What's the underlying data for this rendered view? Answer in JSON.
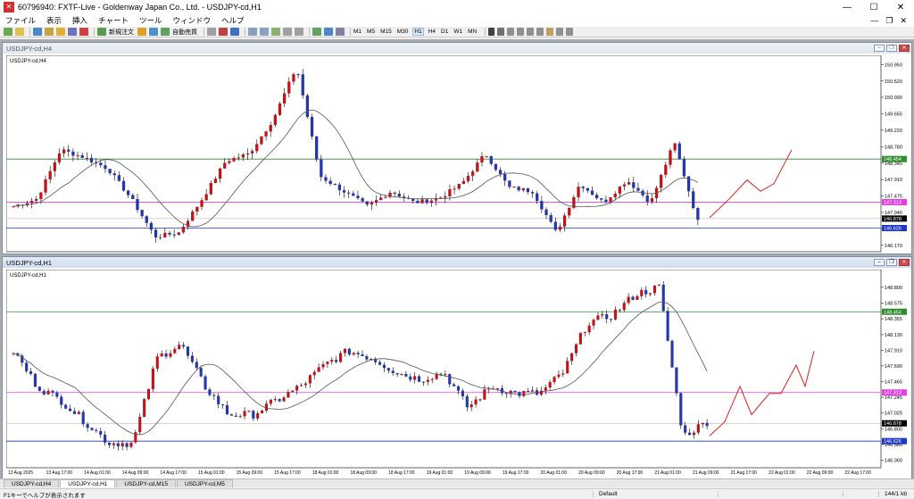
{
  "app": {
    "title": "60796940: FXTF-Live - Goldenway Japan Co., Ltd. - USDJPY-cd,H1",
    "icon": "terminal-icon"
  },
  "menu": [
    "ファイル",
    "表示",
    "挿入",
    "チャート",
    "ツール",
    "ウィンドウ",
    "ヘルプ"
  ],
  "toolbar": {
    "new_order": "新規注文",
    "auto_trade": "自動売買",
    "timeframes": [
      "M1",
      "M5",
      "M15",
      "M30",
      "H1",
      "H4",
      "D1",
      "W1",
      "MN"
    ],
    "active_timeframe": "H1"
  },
  "windows": {
    "top": {
      "caption": "USDJPY-cd,H4",
      "symbol_label": "USDJPY-cd,H4",
      "price_labels": [
        "150.950",
        "150.520",
        "150.090",
        "149.655",
        "149.220",
        "148.780",
        "148.345",
        "147.910",
        "147.475",
        "147.040",
        "146.605",
        "146.170"
      ],
      "marker_labels": [
        {
          "text": "148.454",
          "price": 148.454,
          "color": "#2e8b2e"
        },
        {
          "text": "147.313",
          "price": 147.313,
          "color": "#e040e0"
        },
        {
          "text": "146.878",
          "price": 146.878,
          "color": "#000000"
        },
        {
          "text": "146.626",
          "price": 146.626,
          "color": "#1f35c8"
        }
      ],
      "ylim": [
        146.0,
        151.2
      ]
    },
    "bottom": {
      "caption": "USDJPY-cd,H1",
      "symbol_label": "USDJPY-cd,H1",
      "price_labels": [
        "148.800",
        "148.575",
        "148.355",
        "148.130",
        "147.910",
        "147.690",
        "147.465",
        "147.245",
        "147.025",
        "146.800",
        "146.580",
        "146.360"
      ],
      "marker_labels": [
        {
          "text": "148.454",
          "price": 148.454,
          "color": "#2e8b2e"
        },
        {
          "text": "147.313",
          "price": 147.313,
          "color": "#e040e0"
        },
        {
          "text": "146.878",
          "price": 146.878,
          "color": "#000000"
        },
        {
          "text": "146.626",
          "price": 146.626,
          "color": "#1f35c8"
        }
      ],
      "ylim": [
        146.25,
        149.05
      ],
      "time_labels": [
        "13 Aug 2025",
        "13 Aug 17:00",
        "14 Aug 01:00",
        "14 Aug 09:00",
        "14 Aug 17:00",
        "15 Aug 01:00",
        "15 Aug 09:00",
        "15 Aug 17:00",
        "18 Aug 01:00",
        "18 Aug 09:00",
        "18 Aug 17:00",
        "19 Aug 01:00",
        "19 Aug 09:00",
        "19 Aug 17:00",
        "20 Aug 01:00",
        "20 Aug 09:00",
        "20 Aug 17:00",
        "21 Aug 01:00",
        "21 Aug 09:00",
        "21 Aug 17:00",
        "22 Aug 01:00",
        "22 Aug 09:00",
        "22 Aug 17:00"
      ]
    }
  },
  "tabs": [
    "USDJPY-cd,H4",
    "USDJPY-cd,H1",
    "USDJPY-cd,M15",
    "USDJPY-cd,M5"
  ],
  "active_tab": "USDJPY-cd,H1",
  "status": {
    "help": "F1キーでヘルプが表示されます",
    "profile": "Default",
    "traffic": "144/1 kb"
  },
  "colors": {
    "bull": "#c0141b",
    "bear": "#2338a8",
    "ma_fast": "#555555",
    "forecast": "#e0201c",
    "orange": "#f08030"
  }
}
